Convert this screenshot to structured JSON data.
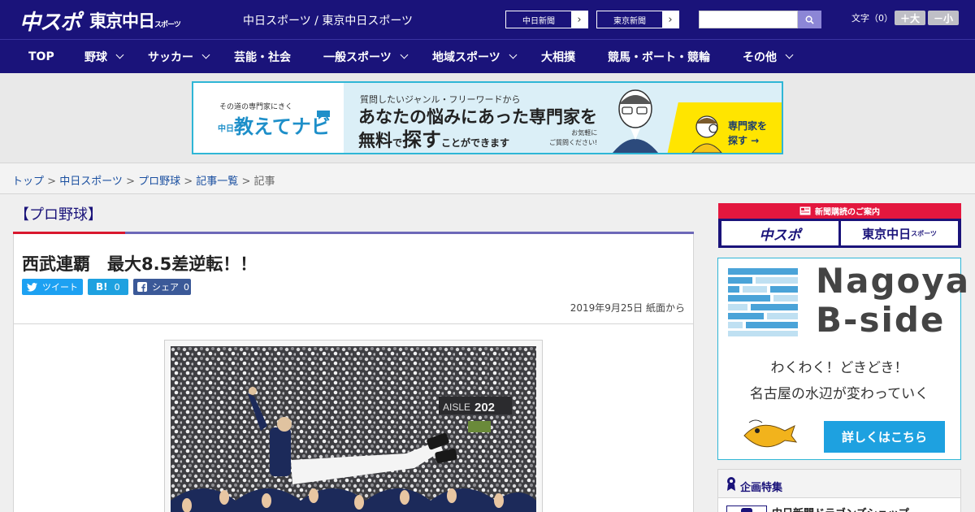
{
  "header": {
    "logo_chuspo": "中スポ",
    "logo_tokyo": "東京中日",
    "logo_tokyo_small": "スポーツ",
    "site_name": "中日スポーツ / 東京中日スポーツ",
    "paper_links": [
      "中日新聞",
      "東京新聞"
    ],
    "search_placeholder": "",
    "font_size_label": "文字（0）",
    "font_larger": "＋大",
    "font_smaller": "－小"
  },
  "nav": {
    "items": [
      {
        "label": "TOP",
        "dropdown": false
      },
      {
        "label": "野球",
        "dropdown": true
      },
      {
        "label": "サッカー",
        "dropdown": true
      },
      {
        "label": "芸能・社会",
        "dropdown": false
      },
      {
        "label": "一般スポーツ",
        "dropdown": true
      },
      {
        "label": "地域スポーツ",
        "dropdown": true
      },
      {
        "label": "大相撲",
        "dropdown": false
      },
      {
        "label": "競馬・ボート・競輪",
        "dropdown": false
      },
      {
        "label": "その他",
        "dropdown": true
      }
    ]
  },
  "ad_banner": {
    "tagline": "その道の専門家にきく",
    "brand": "教えてナビ",
    "brand_prefix": "中日",
    "question": "質問したいジャンル・フリーワードから",
    "headline1": "あなたの悩みにあった専門家を",
    "headline2_a": "無料",
    "headline2_b": "で",
    "headline2_c": "探す",
    "headline2_d": "ことができます",
    "note1": "お気軽に",
    "note2": "ご質問ください!",
    "cta1": "専門家を",
    "cta2": "探す →"
  },
  "breadcrumb": {
    "items": [
      "トップ",
      "中日スポーツ",
      "プロ野球",
      "記事一覧"
    ],
    "current": "記事"
  },
  "article": {
    "category": "【プロ野球】",
    "title": "西武連覇　最大8.5差逆転！！",
    "share": {
      "tweet": "ツイート",
      "hatena_label": "B!",
      "hatena_count": "0",
      "facebook_label": "シェア",
      "facebook_count": "0"
    },
    "date": "2019年9月25日 紙面から"
  },
  "sidebar": {
    "subscribe_header": "新聞購読のご案内",
    "subscribe_chuspo": "中スポ",
    "subscribe_tokyo": "東京中日",
    "subscribe_tokyo_small": "スポーツ",
    "bside_name1": "Nagoya",
    "bside_name2": "B-side",
    "bside_tag1": "わくわく！どきどき！",
    "bside_tag2": "名古屋の水辺が変わっていく",
    "bside_more": "詳しくはこちら",
    "feature_header": "企画特集",
    "feature_item": "中日新聞ドラゴンズショップ"
  },
  "colors": {
    "header_bg": "#1a137a",
    "accent_red": "#d9182e",
    "accent_blue": "#1ea1e0",
    "banner_border": "#2fb6d6"
  }
}
